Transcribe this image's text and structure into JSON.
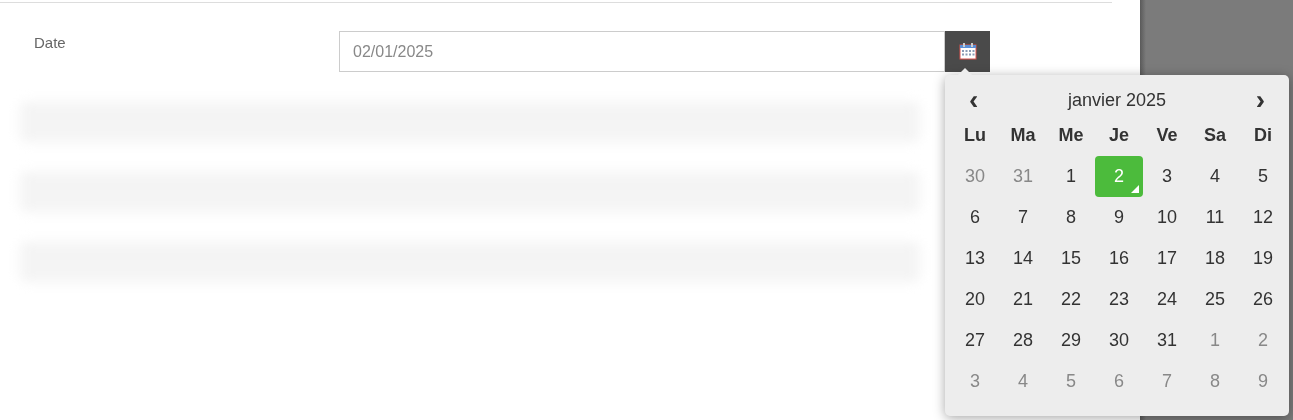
{
  "form": {
    "label": "Date",
    "value": "02/01/2025"
  },
  "datepicker": {
    "prev": "‹",
    "title": "janvier 2025",
    "next": "›",
    "weekdays": [
      "Lu",
      "Ma",
      "Me",
      "Je",
      "Ve",
      "Sa",
      "Di"
    ],
    "weeks": [
      [
        {
          "label": "30",
          "outside": true,
          "selected": false
        },
        {
          "label": "31",
          "outside": true,
          "selected": false
        },
        {
          "label": "1",
          "outside": false,
          "selected": false
        },
        {
          "label": "2",
          "outside": false,
          "selected": true
        },
        {
          "label": "3",
          "outside": false,
          "selected": false
        },
        {
          "label": "4",
          "outside": false,
          "selected": false
        },
        {
          "label": "5",
          "outside": false,
          "selected": false
        }
      ],
      [
        {
          "label": "6",
          "outside": false,
          "selected": false
        },
        {
          "label": "7",
          "outside": false,
          "selected": false
        },
        {
          "label": "8",
          "outside": false,
          "selected": false
        },
        {
          "label": "9",
          "outside": false,
          "selected": false
        },
        {
          "label": "10",
          "outside": false,
          "selected": false
        },
        {
          "label": "11",
          "outside": false,
          "selected": false
        },
        {
          "label": "12",
          "outside": false,
          "selected": false
        }
      ],
      [
        {
          "label": "13",
          "outside": false,
          "selected": false
        },
        {
          "label": "14",
          "outside": false,
          "selected": false
        },
        {
          "label": "15",
          "outside": false,
          "selected": false
        },
        {
          "label": "16",
          "outside": false,
          "selected": false
        },
        {
          "label": "17",
          "outside": false,
          "selected": false
        },
        {
          "label": "18",
          "outside": false,
          "selected": false
        },
        {
          "label": "19",
          "outside": false,
          "selected": false
        }
      ],
      [
        {
          "label": "20",
          "outside": false,
          "selected": false
        },
        {
          "label": "21",
          "outside": false,
          "selected": false
        },
        {
          "label": "22",
          "outside": false,
          "selected": false
        },
        {
          "label": "23",
          "outside": false,
          "selected": false
        },
        {
          "label": "24",
          "outside": false,
          "selected": false
        },
        {
          "label": "25",
          "outside": false,
          "selected": false
        },
        {
          "label": "26",
          "outside": false,
          "selected": false
        }
      ],
      [
        {
          "label": "27",
          "outside": false,
          "selected": false
        },
        {
          "label": "28",
          "outside": false,
          "selected": false
        },
        {
          "label": "29",
          "outside": false,
          "selected": false
        },
        {
          "label": "30",
          "outside": false,
          "selected": false
        },
        {
          "label": "31",
          "outside": false,
          "selected": false
        },
        {
          "label": "1",
          "outside": true,
          "selected": false
        },
        {
          "label": "2",
          "outside": true,
          "selected": false
        }
      ],
      [
        {
          "label": "3",
          "outside": true,
          "selected": false
        },
        {
          "label": "4",
          "outside": true,
          "selected": false
        },
        {
          "label": "5",
          "outside": true,
          "selected": false
        },
        {
          "label": "6",
          "outside": true,
          "selected": false
        },
        {
          "label": "7",
          "outside": true,
          "selected": false
        },
        {
          "label": "8",
          "outside": true,
          "selected": false
        },
        {
          "label": "9",
          "outside": true,
          "selected": false
        }
      ]
    ]
  }
}
